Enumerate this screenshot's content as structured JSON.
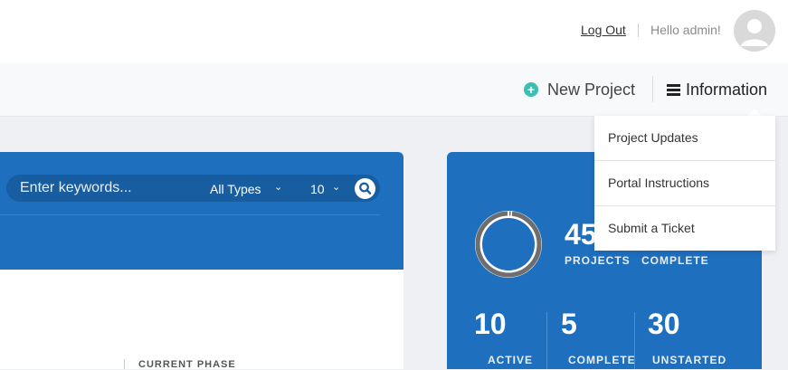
{
  "header": {
    "logout_label": "Log Out",
    "greeting": "Hello admin!"
  },
  "nav": {
    "new_project_label": "New Project",
    "information_label": "Information"
  },
  "information_menu": {
    "items": [
      {
        "label": "Project Updates"
      },
      {
        "label": "Portal Instructions"
      },
      {
        "label": "Submit a Ticket"
      }
    ]
  },
  "search": {
    "placeholder": "Enter keywords...",
    "type_filter": "All Types",
    "page_size": "10"
  },
  "table": {
    "current_phase_header": "CURRENT PHASE"
  },
  "stats": {
    "total_projects": "45",
    "total_projects_label": "PROJECTS",
    "complete_top_label": "COMPLETE",
    "active_count": "10",
    "active_label": "ACTIVE",
    "complete_count": "5",
    "complete_label": "COMPLETE",
    "unstarted_count": "30",
    "unstarted_label": "UNSTARTED"
  },
  "colors": {
    "panel_blue": "#1f6fbf",
    "accent_teal": "#3cbfb3"
  },
  "icons": {
    "add": "plus-circle-icon",
    "menu": "hamburger-icon",
    "search": "search-icon",
    "avatar": "user-avatar-icon"
  }
}
